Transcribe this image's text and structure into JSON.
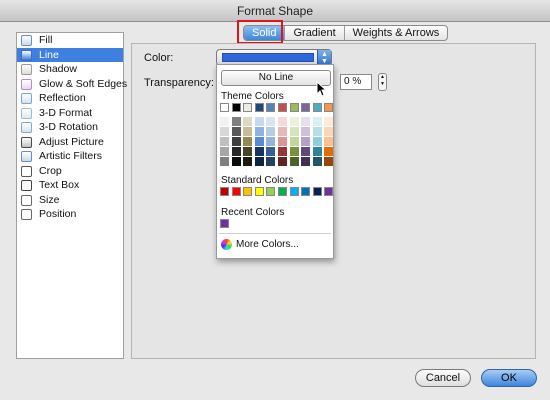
{
  "window": {
    "title": "Format Shape"
  },
  "tabs": [
    {
      "label": "Solid",
      "active": true
    },
    {
      "label": "Gradient",
      "active": false
    },
    {
      "label": "Weights & Arrows",
      "active": false
    }
  ],
  "sidebar": {
    "items": [
      {
        "label": "Fill",
        "icon": "fill-bucket-icon"
      },
      {
        "label": "Line",
        "icon": "line-icon",
        "selected": true
      },
      {
        "label": "Shadow",
        "icon": "shadow-icon"
      },
      {
        "label": "Glow & Soft Edges",
        "icon": "glow-icon"
      },
      {
        "label": "Reflection",
        "icon": "reflection-icon"
      },
      {
        "label": "3-D Format",
        "icon": "3d-format-icon"
      },
      {
        "label": "3-D Rotation",
        "icon": "3d-rotation-icon"
      },
      {
        "label": "Adjust Picture",
        "icon": "adjust-picture-icon"
      },
      {
        "label": "Artistic Filters",
        "icon": "artistic-filters-icon"
      },
      {
        "label": "Crop",
        "icon": "crop-icon"
      },
      {
        "label": "Text Box",
        "icon": "text-box-icon"
      },
      {
        "label": "Size",
        "icon": "size-icon"
      },
      {
        "label": "Position",
        "icon": "position-icon"
      }
    ]
  },
  "panel": {
    "color_label": "Color:",
    "color_value": "#2e66e0",
    "transparency_label": "Transparency:",
    "transparency_value": "0 %"
  },
  "popup": {
    "no_line": "No Line",
    "theme_colors_label": "Theme Colors",
    "standard_colors_label": "Standard Colors",
    "recent_colors_label": "Recent Colors",
    "more_colors": "More Colors...",
    "theme_top": [
      "#ffffff",
      "#000000",
      "#eeece1",
      "#1f497d",
      "#4f81bd",
      "#c0504d",
      "#9bbb59",
      "#8064a2",
      "#4bacc6",
      "#f79646"
    ],
    "theme_shades": [
      [
        "#f2f2f2",
        "#d8d8d8",
        "#bfbfbf",
        "#a5a5a5",
        "#7f7f7f"
      ],
      [
        "#7f7f7f",
        "#595959",
        "#3f3f3f",
        "#262626",
        "#0c0c0c"
      ],
      [
        "#ddd9c3",
        "#c4bd97",
        "#938953",
        "#494429",
        "#1d1b10"
      ],
      [
        "#c6d9f0",
        "#8db3e2",
        "#548dd4",
        "#17365d",
        "#0f243e"
      ],
      [
        "#dbe5f1",
        "#b8cce4",
        "#95b3d7",
        "#366092",
        "#244061"
      ],
      [
        "#f2dcdb",
        "#e5b9b7",
        "#d99694",
        "#953734",
        "#632423"
      ],
      [
        "#ebf1dd",
        "#d7e3bc",
        "#c3d69b",
        "#76923c",
        "#4f6128"
      ],
      [
        "#e5e0ec",
        "#ccc1d9",
        "#b2a2c7",
        "#5f497a",
        "#3f3151"
      ],
      [
        "#dbeef3",
        "#b7dde8",
        "#92cddc",
        "#31859b",
        "#205867"
      ],
      [
        "#fdeada",
        "#fbd5b5",
        "#fac08f",
        "#e36c09",
        "#974806"
      ]
    ],
    "standard": [
      "#c00000",
      "#ff0000",
      "#ffc000",
      "#ffff00",
      "#92d050",
      "#00b050",
      "#00b0f0",
      "#0070c0",
      "#002060",
      "#7030a0"
    ],
    "recent": [
      "#7030a0"
    ]
  },
  "buttons": {
    "cancel": "Cancel",
    "ok": "OK"
  }
}
